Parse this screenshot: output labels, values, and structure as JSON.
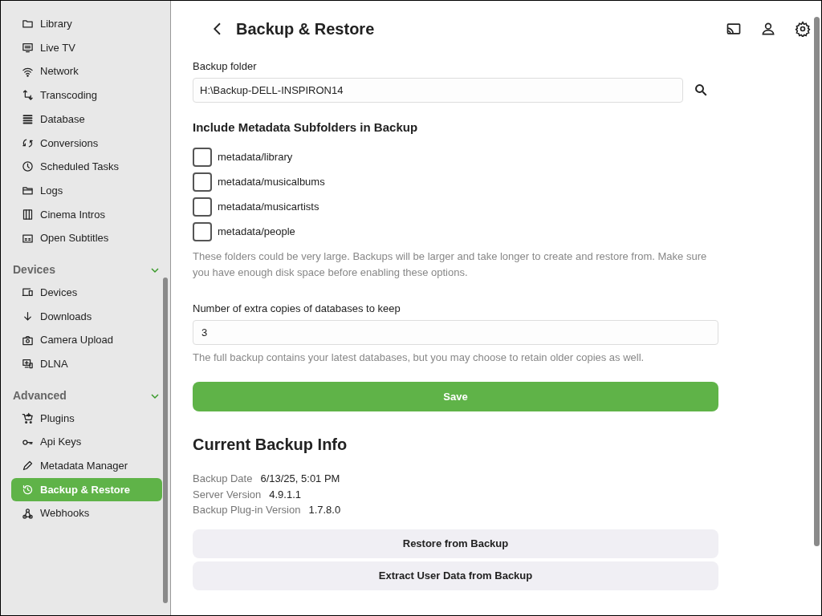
{
  "sidebar": {
    "sections": [
      {
        "items": [
          {
            "label": "Library",
            "selected": false
          },
          {
            "label": "Live TV",
            "selected": false
          },
          {
            "label": "Network",
            "selected": false
          },
          {
            "label": "Transcoding",
            "selected": false
          },
          {
            "label": "Database",
            "selected": false
          },
          {
            "label": "Conversions",
            "selected": false
          },
          {
            "label": "Scheduled Tasks",
            "selected": false
          },
          {
            "label": "Logs",
            "selected": false
          },
          {
            "label": "Cinema Intros",
            "selected": false
          },
          {
            "label": "Open Subtitles",
            "selected": false
          }
        ]
      },
      {
        "title": "Devices",
        "expanded": true,
        "items": [
          {
            "label": "Devices",
            "selected": false
          },
          {
            "label": "Downloads",
            "selected": false
          },
          {
            "label": "Camera Upload",
            "selected": false
          },
          {
            "label": "DLNA",
            "selected": false
          }
        ]
      },
      {
        "title": "Advanced",
        "expanded": true,
        "items": [
          {
            "label": "Plugins",
            "selected": false
          },
          {
            "label": "Api Keys",
            "selected": false
          },
          {
            "label": "Metadata Manager",
            "selected": false
          },
          {
            "label": "Backup & Restore",
            "selected": true
          },
          {
            "label": "Webhooks",
            "selected": false
          }
        ]
      }
    ]
  },
  "header": {
    "title": "Backup & Restore"
  },
  "backup_folder": {
    "label": "Backup folder",
    "value": "H:\\Backup-DELL-INSPIRON14"
  },
  "metadata": {
    "heading": "Include Metadata Subfolders in Backup",
    "options": [
      {
        "label": "metadata/library",
        "checked": false
      },
      {
        "label": "metadata/musicalbums",
        "checked": false
      },
      {
        "label": "metadata/musicartists",
        "checked": false
      },
      {
        "label": "metadata/people",
        "checked": false
      }
    ],
    "help": "These folders could be very large. Backups will be larger and take longer to create and restore from. Make sure you have enough disk space before enabling these options."
  },
  "copies": {
    "label": "Number of extra copies of databases to keep",
    "value": "3",
    "help": "The full backup contains your latest databases, but you may choose to retain older copies as well."
  },
  "save_button": "Save",
  "info": {
    "heading": "Current Backup Info",
    "rows": [
      {
        "label": "Backup Date",
        "value": "6/13/25, 5:01 PM"
      },
      {
        "label": "Server Version",
        "value": "4.9.1.1"
      },
      {
        "label": "Backup Plug-in Version",
        "value": "1.7.8.0"
      }
    ]
  },
  "buttons": [
    "Restore from Backup",
    "Extract User Data from Backup"
  ]
}
